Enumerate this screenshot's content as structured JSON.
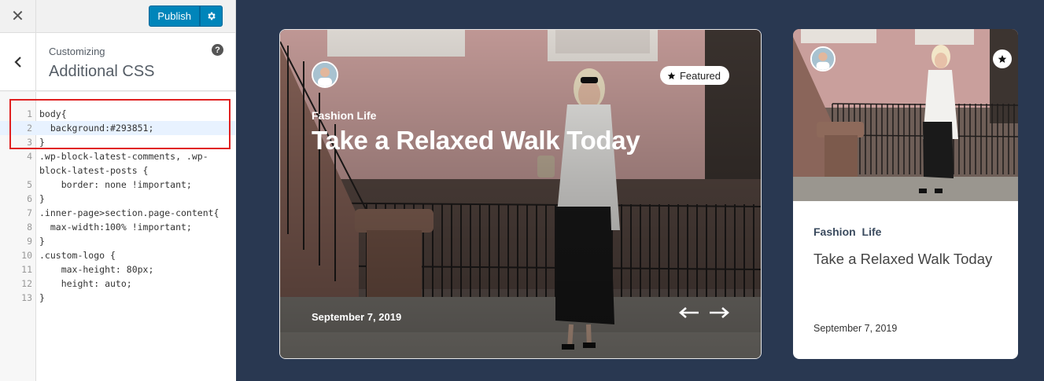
{
  "customizer": {
    "close_icon": "close-icon",
    "publish_label": "Publish",
    "settings_icon": "gear-icon",
    "back_icon": "chevron-left-icon",
    "breadcrumb": "Customizing",
    "section_title": "Additional CSS",
    "help_icon": "?"
  },
  "css_editor": {
    "lines": [
      {
        "n": "1",
        "text": "body{"
      },
      {
        "n": "2",
        "text": "  background:#293851;"
      },
      {
        "n": "3",
        "text": "}"
      },
      {
        "n": "4",
        "text": ".wp-block-latest-comments, .wp-"
      },
      {
        "n": "",
        "text": "block-latest-posts {"
      },
      {
        "n": "5",
        "text": "    border: none !important;"
      },
      {
        "n": "6",
        "text": "}"
      },
      {
        "n": "7",
        "text": ".inner-page>section.page-content{"
      },
      {
        "n": "8",
        "text": "  max-width:100% !important;"
      },
      {
        "n": "9",
        "text": "}"
      },
      {
        "n": "10",
        "text": ".custom-logo {"
      },
      {
        "n": "11",
        "text": "    max-height: 80px;"
      },
      {
        "n": "12",
        "text": "    height: auto;"
      },
      {
        "n": "13",
        "text": "}"
      }
    ],
    "highlighted_line": "2",
    "highlight_box_color": "#e02020"
  },
  "preview": {
    "background_color": "#293851",
    "featured_card": {
      "badge_label": "Featured",
      "badge_icon": "star-icon",
      "category": "Fashion Life",
      "title": "Take a Relaxed Walk Today",
      "date": "September 7, 2019",
      "prev_icon": "arrow-left-icon",
      "next_icon": "arrow-right-icon"
    },
    "side_card": {
      "badge_icon": "star-icon",
      "category": "Fashion  Life",
      "title": "Take a Relaxed Walk Today",
      "date": "September 7, 2019"
    }
  }
}
